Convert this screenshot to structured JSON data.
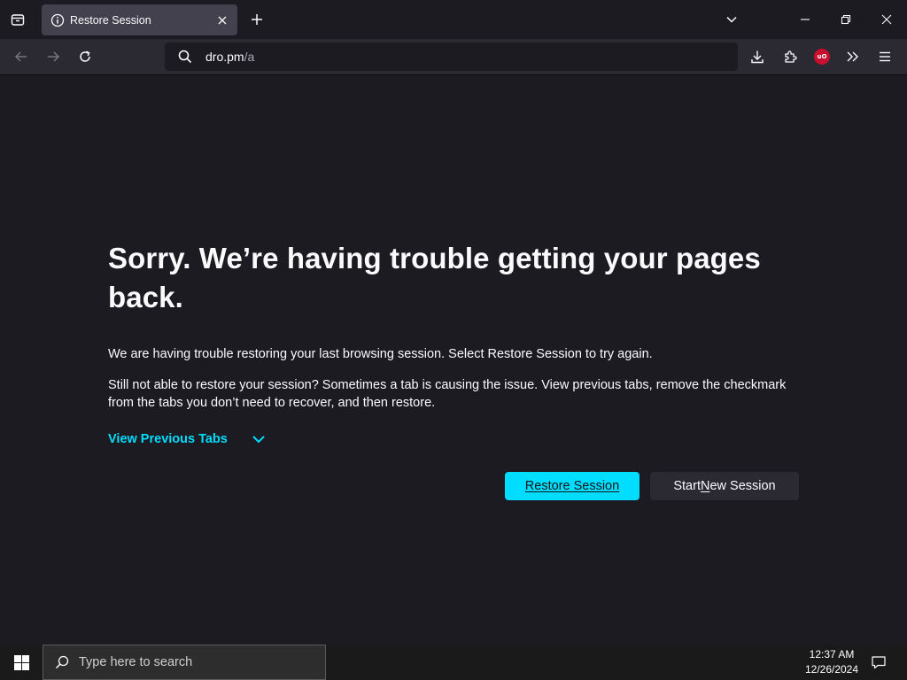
{
  "browser": {
    "tab": {
      "title": "Restore Session",
      "icon": "info-icon"
    },
    "url": {
      "host": "dro.pm",
      "path": "/a"
    },
    "toolbar_icons": [
      "back-icon",
      "forward-icon",
      "reload-icon",
      "download-icon",
      "extensions-icon",
      "ublock-icon",
      "overflow-icon",
      "menu-icon"
    ],
    "ublock_badge": "uO"
  },
  "page": {
    "heading": "Sorry. We’re having trouble getting your pages back.",
    "para1": "We are having trouble restoring your last browsing session. Select Restore Session to try again.",
    "para2": "Still not able to restore your session? Sometimes a tab is causing the issue. View previous tabs, remove the checkmark from the tabs you don’t need to recover, and then restore.",
    "view_tabs_label": "View Previous Tabs",
    "restore_button": "Restore Session",
    "new_session_button": {
      "before": "Start ",
      "accel": "N",
      "after": "ew Session"
    }
  },
  "taskbar": {
    "search_placeholder": "Type here to search",
    "time": "12:37 AM",
    "date": "12/26/2024"
  },
  "colors": {
    "accent": "#00ddff",
    "content_bg": "#1c1b22",
    "toolbar_bg": "#2b2a33",
    "tab_bg": "#42414d",
    "ublock_red": "#c8102e"
  }
}
